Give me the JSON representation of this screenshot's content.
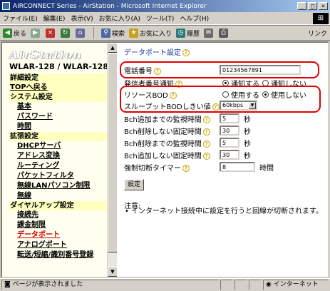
{
  "window": {
    "title": "AIRCONNECT Series - AirStation - Microsoft Internet Explorer"
  },
  "menu": [
    "ファイル(E)",
    "編集(E)",
    "表示(V)",
    "お気に入り(A)",
    "ツール(T)",
    "ヘルプ(H)"
  ],
  "toolbar": {
    "back": "戻る",
    "search": "検索",
    "favorites": "お気に入り",
    "history": "履歴",
    "links": "リンク"
  },
  "sidebar": {
    "logo": "AirStation",
    "model": "WLAR-128 / WLAR-128G",
    "items": [
      {
        "label": "詳細設定",
        "type": "cat"
      },
      {
        "label": "TOPへ戻る",
        "type": "catlink"
      },
      {
        "label": "システム設定",
        "type": "cat"
      },
      {
        "label": "基本",
        "type": "link"
      },
      {
        "label": "パスワード",
        "type": "link"
      },
      {
        "label": "時間",
        "type": "link"
      },
      {
        "label": "拡張設定",
        "type": "cat"
      },
      {
        "label": "DHCPサーバ",
        "type": "link"
      },
      {
        "label": "アドレス変換",
        "type": "link"
      },
      {
        "label": "ルーティング",
        "type": "link"
      },
      {
        "label": "パケットフィルタ",
        "type": "link"
      },
      {
        "label": "無線LANパソコン制限",
        "type": "link"
      },
      {
        "label": "無線",
        "type": "link"
      },
      {
        "label": "ダイヤルアップ設定",
        "type": "cat"
      },
      {
        "label": "接続先",
        "type": "link"
      },
      {
        "label": "課金制限",
        "type": "link"
      },
      {
        "label": "データポート",
        "type": "link",
        "active": true
      },
      {
        "label": "アナログポート",
        "type": "link"
      },
      {
        "label": "転送/短縮/識別番号登録",
        "type": "link"
      }
    ]
  },
  "main": {
    "title": "データポート設定",
    "phone": {
      "label": "電話番号",
      "value": "01234567891"
    },
    "caller_id": {
      "label": "発信者番号通知",
      "opt_on": "通知する",
      "opt_off": "通知しない",
      "selected": "on"
    },
    "resource_bod": {
      "label": "リソースBOD",
      "opt_on": "使用する",
      "opt_off": "使用しない",
      "selected": "off"
    },
    "throughput": {
      "label": "スループットBODしきい値",
      "value": "60kbps"
    },
    "monitors": [
      {
        "label": "Bch追加までの監視時間",
        "value": "5",
        "unit": "秒"
      },
      {
        "label": "Bch削除しない固定時間",
        "value": "30",
        "unit": "秒"
      },
      {
        "label": "Bch削除までの監視時間",
        "value": "5",
        "unit": "秒"
      },
      {
        "label": "Bch追加しない固定時間",
        "value": "30",
        "unit": "秒"
      },
      {
        "label": "強制切断タイマー",
        "value": "8",
        "unit": "時間"
      }
    ],
    "submit": "設定",
    "note_title": "注意:",
    "note_text": "インターネット接続中に設定を行うと回線が切断されます。"
  },
  "status": {
    "text": "ページが表示されました",
    "zone": "インターネット"
  }
}
